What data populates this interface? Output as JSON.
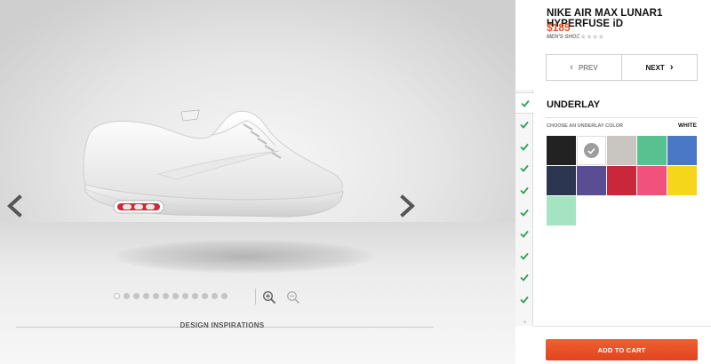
{
  "product": {
    "title": "NIKE AIR MAX LUNAR1 HYPERFUSE iD",
    "price": "$185",
    "subtitle": "MEN'S SHOE",
    "rating_stars": "★★★★★",
    "rating_value": 0,
    "rating_max": 5
  },
  "nav": {
    "prev_label": "PREV",
    "next_label": "NEXT",
    "prev_icon": "chevron-left-icon",
    "next_icon": "chevron-right-icon"
  },
  "viewer": {
    "prev_arrow": "chevron-left-icon",
    "next_arrow": "chevron-right-icon",
    "view_count": 12,
    "active_view": 1,
    "zoom_in_icon": "zoom-in-icon",
    "zoom_out_icon": "zoom-out-icon",
    "inspirations_label": "DESIGN INSPIRATIONS"
  },
  "section": {
    "title": "UNDERLAY",
    "subtitle": "CHOOSE AN UNDERLAY COLOR",
    "selected_value": "WHITE"
  },
  "steps": {
    "completed_count": 10,
    "icon": "checkmark-icon",
    "check_color": "#2e9f5b"
  },
  "swatches": [
    {
      "color": "#222222",
      "selected": false
    },
    {
      "color": "#ffffff",
      "selected": true
    },
    {
      "color": "#c9c6c1",
      "selected": false
    },
    {
      "color": "#59c08f",
      "selected": false
    },
    {
      "color": "#4a77c6",
      "selected": false
    },
    {
      "color": "#2d3650",
      "selected": false
    },
    {
      "color": "#5b4d93",
      "selected": false
    },
    {
      "color": "#c8283a",
      "selected": false
    },
    {
      "color": "#f0527d",
      "selected": false
    },
    {
      "color": "#f6d61a",
      "selected": false
    },
    {
      "color": "#a5e4c3",
      "selected": false
    }
  ],
  "cart": {
    "label": "ADD TO CART",
    "color": "#e8542a"
  }
}
